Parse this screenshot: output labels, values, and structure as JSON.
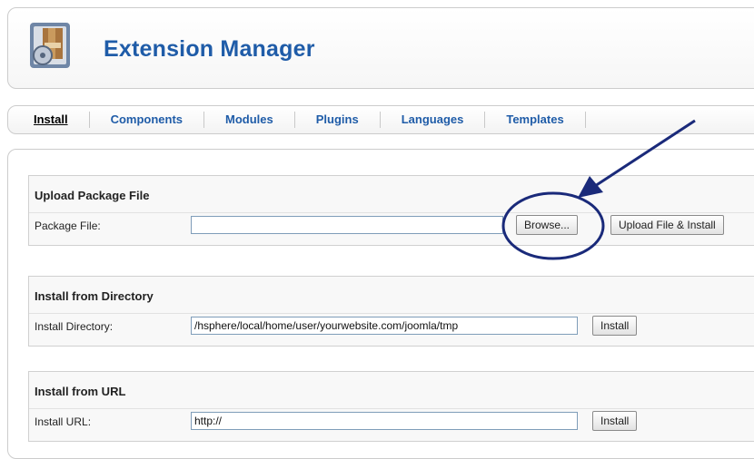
{
  "header": {
    "title": "Extension Manager",
    "icon": "extension-box-icon"
  },
  "tabs": [
    {
      "label": "Install",
      "active": true
    },
    {
      "label": "Components",
      "active": false
    },
    {
      "label": "Modules",
      "active": false
    },
    {
      "label": "Plugins",
      "active": false
    },
    {
      "label": "Languages",
      "active": false
    },
    {
      "label": "Templates",
      "active": false
    }
  ],
  "upload": {
    "title": "Upload Package File",
    "label": "Package File:",
    "value": "",
    "browse_label": "Browse...",
    "submit_label": "Upload File & Install"
  },
  "directory": {
    "title": "Install from Directory",
    "label": "Install Directory:",
    "value": "/hsphere/local/home/user/yourwebsite.com/joomla/tmp",
    "submit_label": "Install"
  },
  "url": {
    "title": "Install from URL",
    "label": "Install URL:",
    "value": "http://",
    "submit_label": "Install"
  },
  "colors": {
    "title_blue": "#1f5ca8",
    "annotation_navy": "#1a2a7a"
  }
}
